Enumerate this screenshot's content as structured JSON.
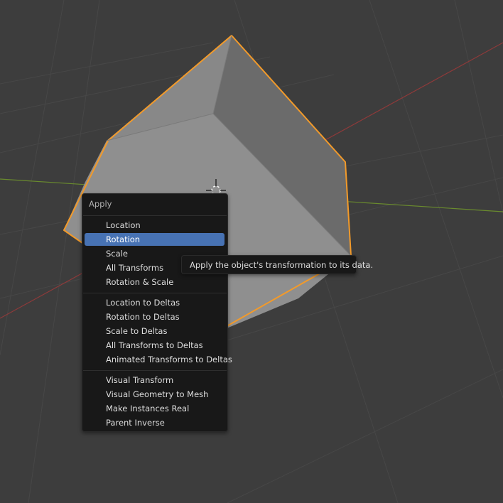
{
  "colors": {
    "viewport_bg": "#3d3d3d",
    "grid_line": "#4a4a4a",
    "x_axis": "#8e3a3a",
    "y_axis": "#6a8b2e",
    "selection_outline": "#f29a2a",
    "menu_bg": "#181818",
    "menu_highlight": "#4772b3"
  },
  "viewport": {
    "selected_object": "cube",
    "origin_icon": "3d-cursor-icon"
  },
  "menu": {
    "title": "Apply",
    "groups": [
      [
        "Location",
        "Rotation",
        "Scale",
        "All Transforms",
        "Rotation & Scale"
      ],
      [
        "Location to Deltas",
        "Rotation to Deltas",
        "Scale to Deltas",
        "All Transforms to Deltas",
        "Animated Transforms to Deltas"
      ],
      [
        "Visual Transform",
        "Visual Geometry to Mesh",
        "Make Instances Real",
        "Parent Inverse"
      ]
    ],
    "highlighted": "Rotation"
  },
  "tooltip": {
    "text": "Apply the object's transformation to its data."
  }
}
